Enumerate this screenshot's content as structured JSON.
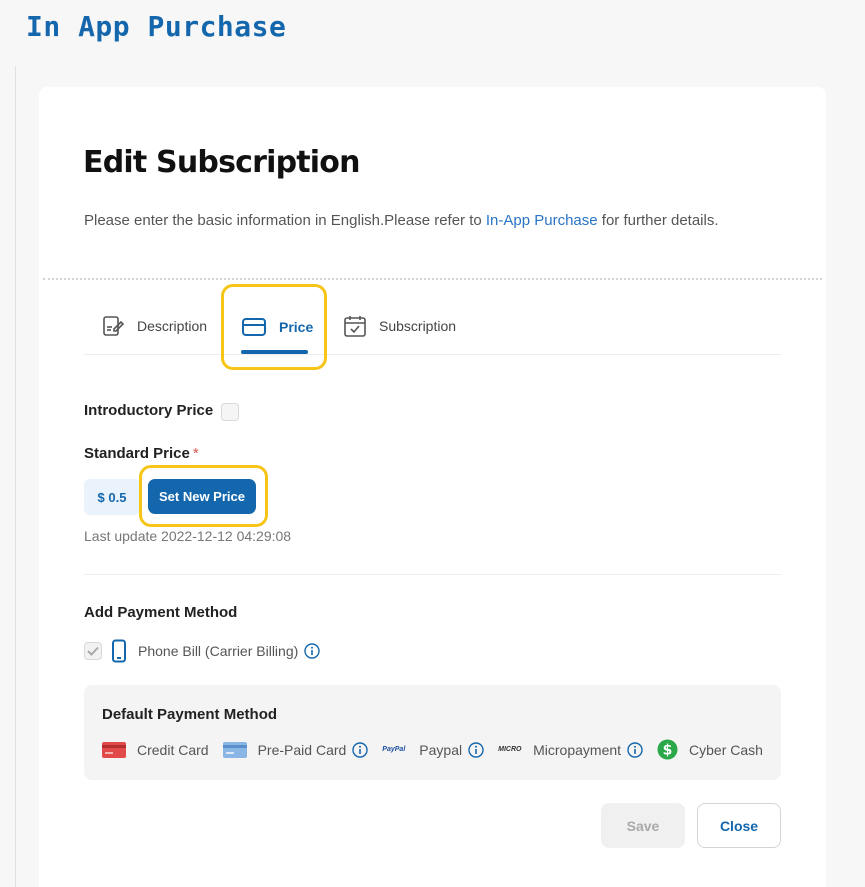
{
  "page": {
    "title": "In App Purchase"
  },
  "card": {
    "title": "Edit Subscription",
    "info_before": "Please enter the basic information in English.Please refer to ",
    "info_link": "In-App Purchase",
    "info_after": " for further details."
  },
  "tabs": [
    {
      "label": "Description",
      "icon": "document-edit-icon"
    },
    {
      "label": "Price",
      "icon": "card-icon",
      "active": true
    },
    {
      "label": "Subscription",
      "icon": "calendar-check-icon"
    }
  ],
  "price": {
    "introductory_label": "Introductory Price",
    "introductory_checked": false,
    "standard_label": "Standard Price",
    "required_mark": "*",
    "value": "$ 0.5",
    "set_button": "Set New Price",
    "last_update": "Last update 2022-12-12 04:29:08"
  },
  "payment": {
    "add_label": "Add Payment Method",
    "phone_bill": "Phone Bill (Carrier Billing)",
    "phone_bill_checked": true,
    "default_label": "Default Payment Method",
    "methods": [
      {
        "label": "Credit Card",
        "icon": "credit-card-icon"
      },
      {
        "label": "Pre-Paid Card",
        "icon": "prepaid-card-icon"
      },
      {
        "label": "Paypal",
        "icon": "paypal-icon",
        "icon_text": "PayPal"
      },
      {
        "label": "Micropayment",
        "icon": "micropayment-icon",
        "icon_text": "MICRO"
      },
      {
        "label": "Cyber Cash",
        "icon": "cyber-cash-icon"
      }
    ]
  },
  "actions": {
    "save": "Save",
    "close": "Close"
  },
  "colors": {
    "accent": "#1467ad",
    "highlight": "#f6c518",
    "cash_green": "#2aa84a"
  }
}
